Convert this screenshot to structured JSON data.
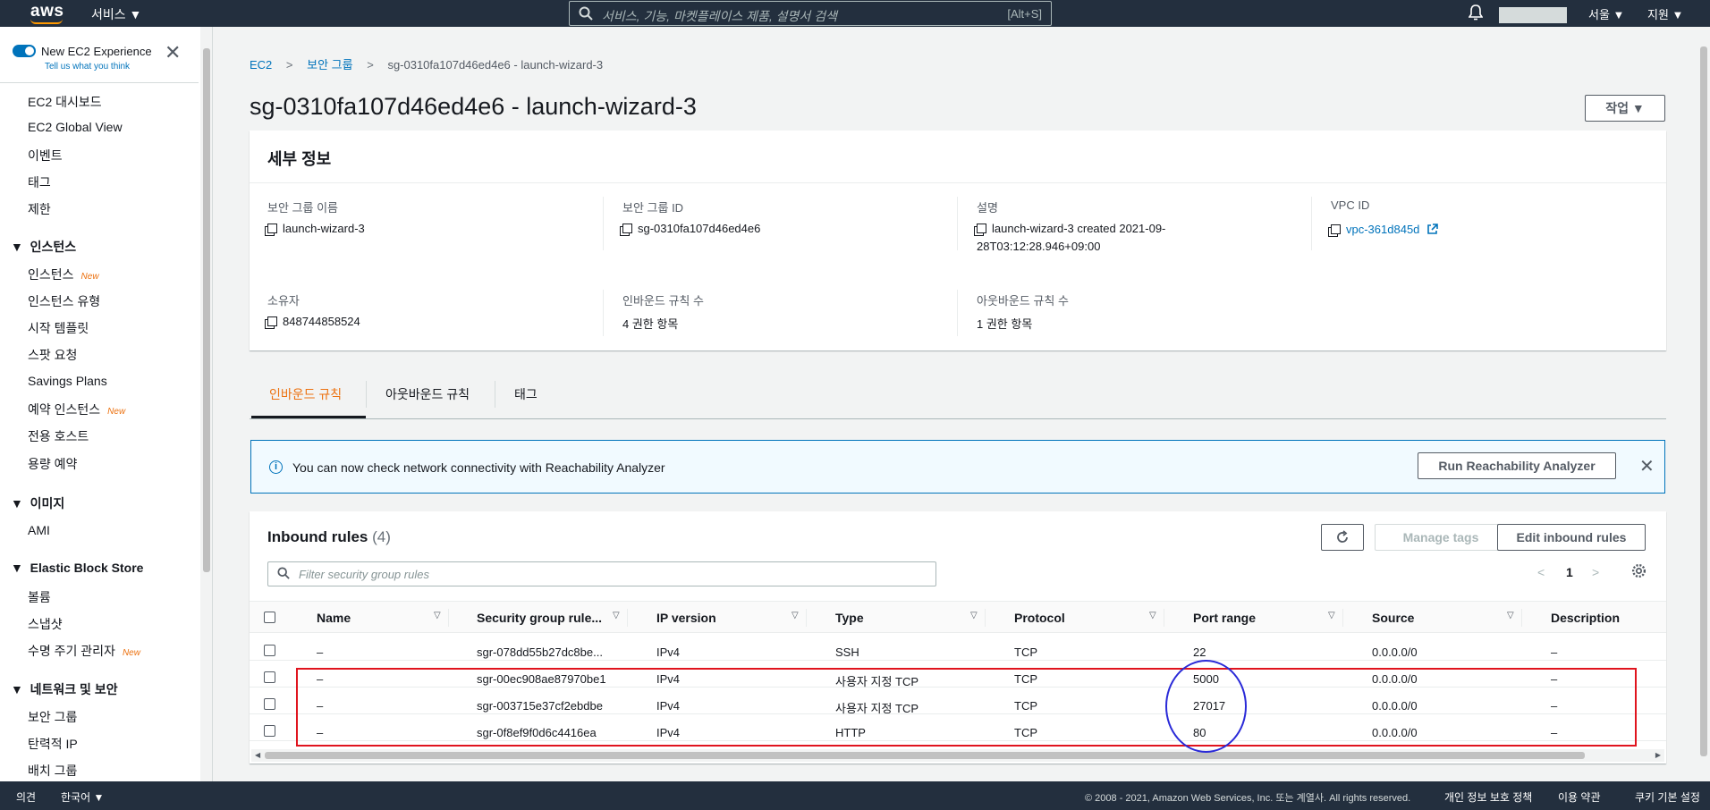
{
  "topnav": {
    "logo": "aws",
    "services": "서비스 ▼",
    "search_placeholder": "서비스, 기능, 마켓플레이스 제품, 설명서 검색",
    "search_shortcut": "[Alt+S]",
    "region": "서울 ▼",
    "support": "지원 ▼",
    "icons": {
      "search": "search-icon",
      "bell": "bell-icon"
    }
  },
  "sidebar": {
    "new_experience_title": "New EC2 Experience",
    "new_experience_link": "Tell us what you think",
    "new_badge": "New",
    "items": [
      {
        "label": "EC2 대시보드"
      },
      {
        "label": "EC2 Global View"
      },
      {
        "label": "이벤트"
      },
      {
        "label": "태그"
      },
      {
        "label": "제한"
      }
    ],
    "sections": [
      {
        "title": "인스턴스",
        "items": [
          {
            "label": "인스턴스",
            "new": true
          },
          {
            "label": "인스턴스 유형"
          },
          {
            "label": "시작 템플릿"
          },
          {
            "label": "스팟 요청"
          },
          {
            "label": "Savings Plans"
          },
          {
            "label": "예약 인스턴스",
            "new": true
          },
          {
            "label": "전용 호스트"
          },
          {
            "label": "용량 예약"
          }
        ]
      },
      {
        "title": "이미지",
        "items": [
          {
            "label": "AMI"
          }
        ]
      },
      {
        "title": "Elastic Block Store",
        "items": [
          {
            "label": "볼륨"
          },
          {
            "label": "스냅샷"
          },
          {
            "label": "수명 주기 관리자",
            "new": true
          }
        ]
      },
      {
        "title": "네트워크 및 보안",
        "items": [
          {
            "label": "보안 그룹"
          },
          {
            "label": "탄력적 IP"
          },
          {
            "label": "배치 그룹"
          }
        ]
      }
    ]
  },
  "breadcrumb": {
    "ec2": "EC2",
    "security_groups": "보안 그룹",
    "current": "sg-0310fa107d46ed4e6 - launch-wizard-3"
  },
  "page_title": "sg-0310fa107d46ed4e6 - launch-wizard-3",
  "actions_button": "작업 ▼",
  "details": {
    "heading": "세부 정보",
    "sg_name_label": "보안 그룹 이름",
    "sg_name": "launch-wizard-3",
    "sg_id_label": "보안 그룹 ID",
    "sg_id": "sg-0310fa107d46ed4e6",
    "desc_label": "설명",
    "desc_line1": "launch-wizard-3 created 2021-09-",
    "desc_line2": "28T03:12:28.946+09:00",
    "vpc_label": "VPC ID",
    "vpc": "vpc-361d845d",
    "owner_label": "소유자",
    "owner": "848744858524",
    "inbound_count_label": "인바운드 규칙 수",
    "inbound_count": "4 권한 항목",
    "outbound_count_label": "아웃바운드 규칙 수",
    "outbound_count": "1 권한 항목"
  },
  "tabs": [
    {
      "label": "인바운드 규칙",
      "active": true
    },
    {
      "label": "아웃바운드 규칙"
    },
    {
      "label": "태그"
    }
  ],
  "info_banner": {
    "text": "You can now check network connectivity with Reachability Analyzer",
    "button": "Run Reachability Analyzer"
  },
  "rules": {
    "title": "Inbound rules",
    "count": "(4)",
    "manage_tags": "Manage tags",
    "edit": "Edit inbound rules",
    "filter_placeholder": "Filter security group rules",
    "page": "1",
    "columns": [
      "Name",
      "Security group rule...",
      "IP version",
      "Type",
      "Protocol",
      "Port range",
      "Source",
      "Description"
    ],
    "rows": [
      {
        "name": "–",
        "rule_id": "sgr-078dd55b27dc8be...",
        "ip": "IPv4",
        "type": "SSH",
        "protocol": "TCP",
        "port": "22",
        "source": "0.0.0.0/0",
        "desc": "–"
      },
      {
        "name": "–",
        "rule_id": "sgr-00ec908ae87970be1",
        "ip": "IPv4",
        "type": "사용자 지정 TCP",
        "protocol": "TCP",
        "port": "5000",
        "source": "0.0.0.0/0",
        "desc": "–"
      },
      {
        "name": "–",
        "rule_id": "sgr-003715e37cf2ebdbe",
        "ip": "IPv4",
        "type": "사용자 지정 TCP",
        "protocol": "TCP",
        "port": "27017",
        "source": "0.0.0.0/0",
        "desc": "–"
      },
      {
        "name": "–",
        "rule_id": "sgr-0f8ef9f0d6c4416ea",
        "ip": "IPv4",
        "type": "HTTP",
        "protocol": "TCP",
        "port": "80",
        "source": "0.0.0.0/0",
        "desc": "–"
      }
    ]
  },
  "footer": {
    "feedback": "의견",
    "language": "한국어 ▼",
    "copyright": "© 2008 - 2021, Amazon Web Services, Inc. 또는 계열사. All rights reserved.",
    "privacy": "개인 정보 보호 정책",
    "terms": "이용 약관",
    "cookies": "쿠키 기본 설정"
  },
  "colors": {
    "nav_bg": "#232f3e",
    "link": "#0073bb",
    "accent_orange": "#ec7211",
    "highlight_red": "#e0141e",
    "highlight_blue": "#2a2ad8"
  }
}
